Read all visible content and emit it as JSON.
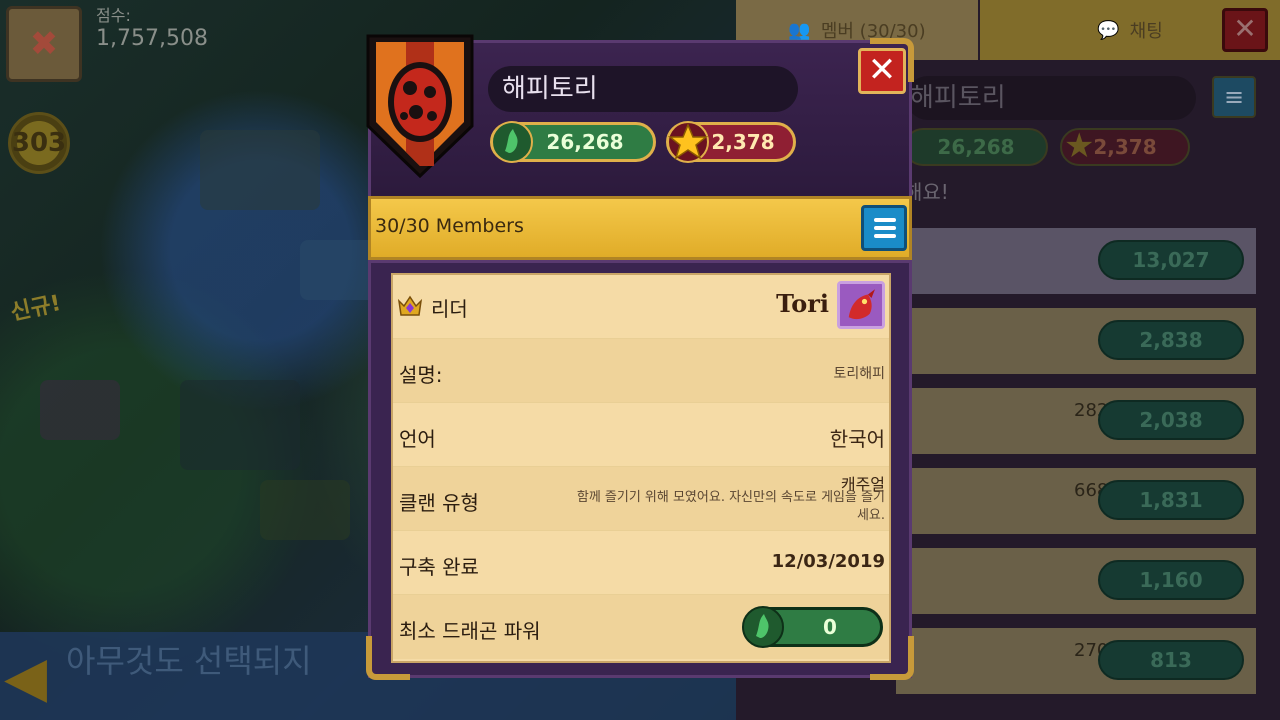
{
  "background": {
    "score_label": "점수:",
    "score_value": "1,757,508",
    "level": "303",
    "new_label": "신규!",
    "bottom_text": "아무것도 선택되지"
  },
  "right_panel": {
    "tab_members": "멤버 (30/30)",
    "tab_chat": "채팅",
    "clan_name": "해피토리",
    "power": "26,268",
    "stars": "2,378",
    "sub_text": "해요!",
    "rows": [
      {
        "extra": "",
        "power": "13,027"
      },
      {
        "extra": "",
        "power": "2,838"
      },
      {
        "extra": "282",
        "power": "2,038"
      },
      {
        "extra": "668",
        "power": "1,831"
      },
      {
        "extra": "",
        "power": "1,160"
      },
      {
        "extra": "270",
        "power": "813"
      }
    ]
  },
  "dialog": {
    "clan_name": "해피토리",
    "power": "26,268",
    "stars": "2,378",
    "members_text": "30/30 Members",
    "leader_label": "리더",
    "leader_name": "Tori",
    "description_label": "설명:",
    "description_value": "토리해피",
    "language_label": "언어",
    "language_value": "한국어",
    "type_label": "클랜 유형",
    "type_value": "캐주얼",
    "type_description": "함께 즐기기 위해 모였어요. 자신만의 속도로 게임을 즐기세요.",
    "founded_label": "구축 완료",
    "founded_value": "12/03/2019",
    "min_power_label": "최소 드래곤 파워",
    "min_power_value": "0"
  },
  "colors": {
    "accent_gold": "#e0ac28",
    "close_red": "#c3231f",
    "power_green": "#2f7c44",
    "stars_red": "#8f1f33",
    "menu_blue": "#1a8cc8"
  },
  "icons": {
    "shield": "ladybug-egg-shield-icon",
    "power": "green-dragon-power-icon",
    "star": "gold-star-icon",
    "crown": "leader-crown-icon",
    "menu": "hamburger-menu-icon",
    "close": "close-x-icon"
  }
}
